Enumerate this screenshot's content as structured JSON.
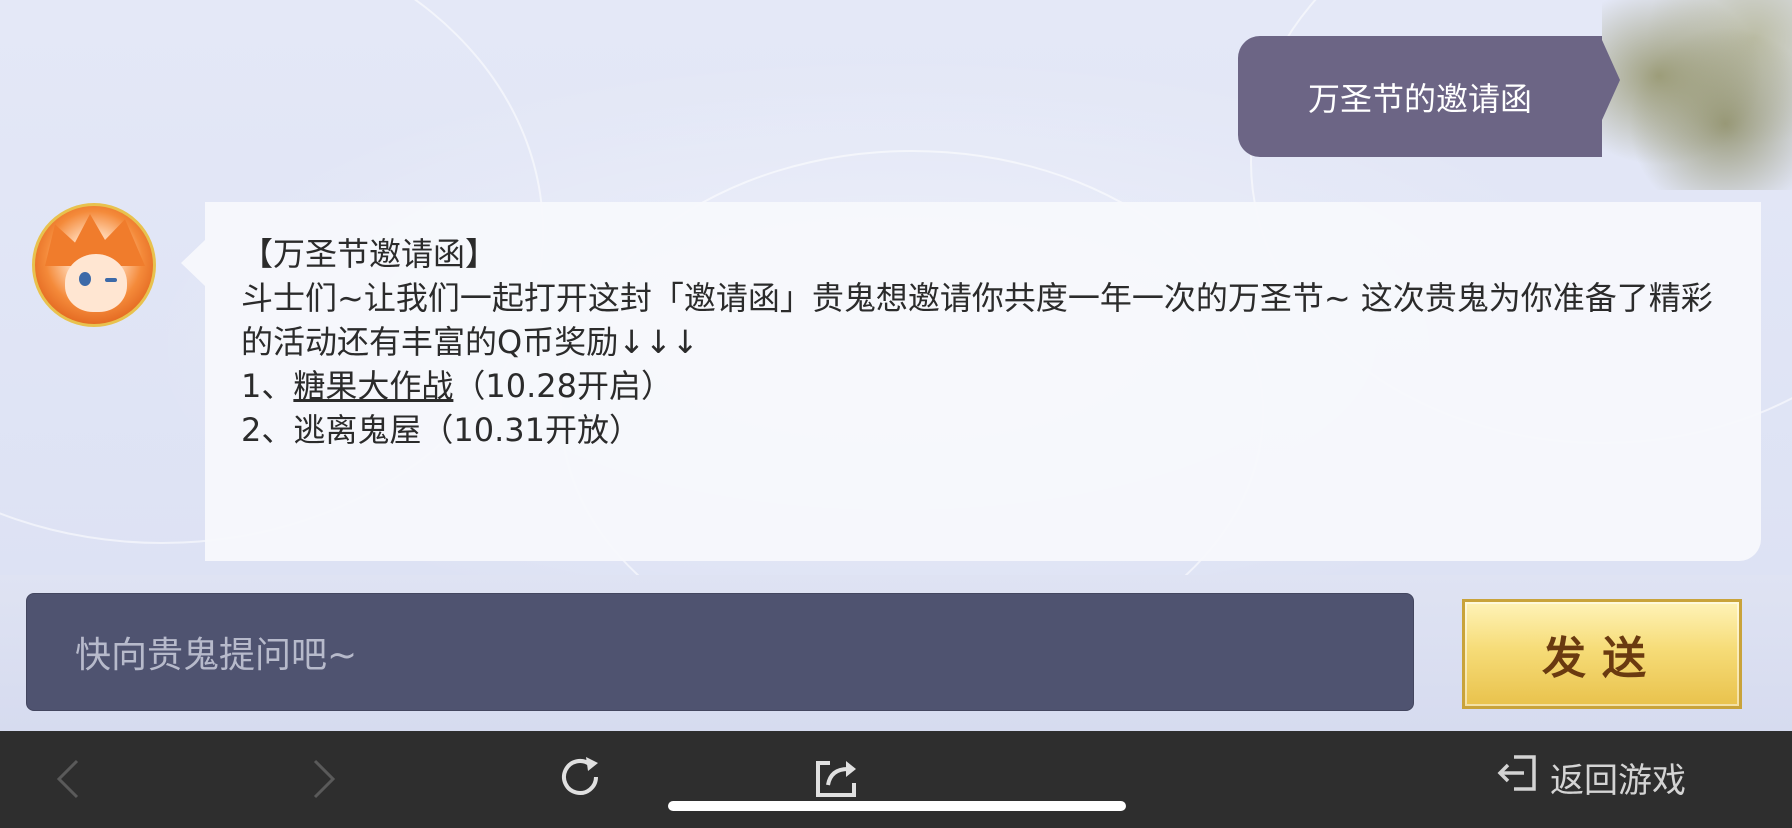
{
  "user_message": {
    "text": "万圣节的邀请函"
  },
  "bot_message": {
    "title": "【万圣节邀请函】",
    "body": "斗士们~让我们一起打开这封「邀请函」贵鬼想邀请你共度一年一次的万圣节~ 这次贵鬼为你准备了精彩的活动还有丰富的Q币奖励↓↓↓",
    "items": [
      {
        "prefix": "1、",
        "link_text": "糖果大作战",
        "suffix": "（10.28开启）"
      },
      {
        "prefix": "2、",
        "link_text": "",
        "suffix": "逃离鬼屋（10.31开放）"
      }
    ]
  },
  "input": {
    "placeholder": "快向贵鬼提问吧~"
  },
  "send_button": {
    "label": "发送"
  },
  "nav": {
    "return_label": "返回游戏",
    "back_icon": "chevron-left-icon",
    "forward_icon": "chevron-right-icon",
    "refresh_icon": "refresh-icon",
    "share_icon": "share-icon",
    "return_icon": "exit-icon"
  },
  "colors": {
    "user_bubble": "#6c6585",
    "input_bg": "#4f5370",
    "send_gold": "#f6dc78",
    "nav_bg": "#2e2e2e"
  }
}
